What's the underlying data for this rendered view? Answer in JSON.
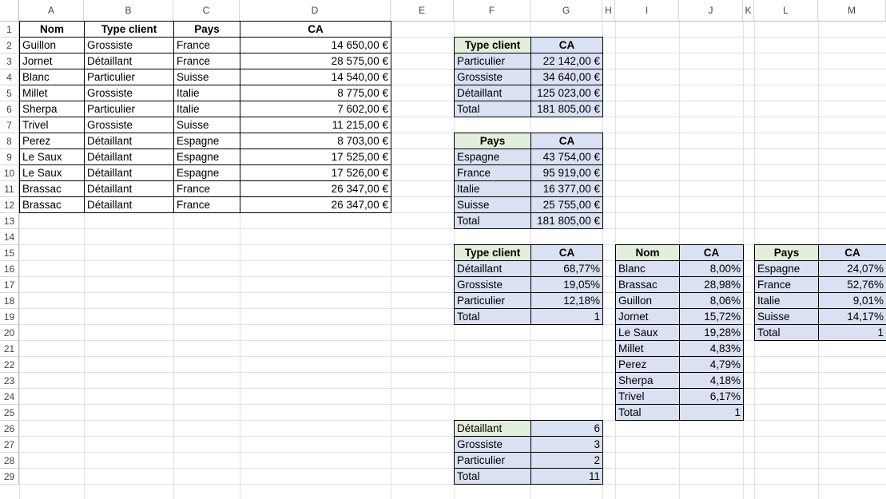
{
  "columns": [
    "A",
    "B",
    "C",
    "D",
    "E",
    "F",
    "G",
    "H",
    "I",
    "J",
    "K",
    "L",
    "M"
  ],
  "rows": [
    "1",
    "2",
    "3",
    "4",
    "5",
    "6",
    "7",
    "8",
    "9",
    "10",
    "11",
    "12",
    "13",
    "14",
    "15",
    "16",
    "17",
    "18",
    "19",
    "20",
    "21",
    "22",
    "23",
    "24",
    "25",
    "26",
    "27",
    "28",
    "29"
  ],
  "main_table": {
    "headers": [
      "Nom",
      "Type client",
      "Pays",
      "CA"
    ],
    "rows": [
      [
        "Guillon",
        "Grossiste",
        "France",
        "14 650,00 €"
      ],
      [
        "Jornet",
        "Détaillant",
        "France",
        "28 575,00 €"
      ],
      [
        "Blanc",
        "Particulier",
        "Suisse",
        "14 540,00 €"
      ],
      [
        "Millet",
        "Grossiste",
        "Italie",
        "8 775,00 €"
      ],
      [
        "Sherpa",
        "Particulier",
        "Italie",
        "7 602,00 €"
      ],
      [
        "Trivel",
        "Grossiste",
        "Suisse",
        "11 215,00 €"
      ],
      [
        "Perez",
        "Détaillant",
        "Espagne",
        "8 703,00 €"
      ],
      [
        "Le Saux",
        "Détaillant",
        "Espagne",
        "17 525,00 €"
      ],
      [
        "Le Saux",
        "Détaillant",
        "Espagne",
        "17 526,00 €"
      ],
      [
        "Brassac",
        "Détaillant",
        "France",
        "26 347,00 €"
      ],
      [
        "Brassac",
        "Détaillant",
        "France",
        "26 347,00 €"
      ]
    ]
  },
  "type_ca": {
    "headers": [
      "Type client",
      "CA"
    ],
    "rows": [
      [
        "Particulier",
        "22 142,00 €"
      ],
      [
        "Grossiste",
        "34 640,00 €"
      ],
      [
        "Détaillant",
        "125 023,00 €"
      ],
      [
        "Total",
        "181 805,00 €"
      ]
    ]
  },
  "pays_ca": {
    "headers": [
      "Pays",
      "CA"
    ],
    "rows": [
      [
        "Espagne",
        "43 754,00 €"
      ],
      [
        "France",
        "95 919,00 €"
      ],
      [
        "Italie",
        "16 377,00 €"
      ],
      [
        "Suisse",
        "25 755,00 €"
      ],
      [
        "Total",
        "181 805,00 €"
      ]
    ]
  },
  "type_pct": {
    "headers": [
      "Type client",
      "CA"
    ],
    "rows": [
      [
        "Détaillant",
        "68,77%"
      ],
      [
        "Grossiste",
        "19,05%"
      ],
      [
        "Particulier",
        "12,18%"
      ],
      [
        "Total",
        "1"
      ]
    ]
  },
  "nom_pct": {
    "headers": [
      "Nom",
      "CA"
    ],
    "rows": [
      [
        "Blanc",
        "8,00%"
      ],
      [
        "Brassac",
        "28,98%"
      ],
      [
        "Guillon",
        "8,06%"
      ],
      [
        "Jornet",
        "15,72%"
      ],
      [
        "Le Saux",
        "19,28%"
      ],
      [
        "Millet",
        "4,83%"
      ],
      [
        "Perez",
        "4,79%"
      ],
      [
        "Sherpa",
        "4,18%"
      ],
      [
        "Trivel",
        "6,17%"
      ],
      [
        "Total",
        "1"
      ]
    ]
  },
  "pays_pct": {
    "headers": [
      "Pays",
      "CA"
    ],
    "rows": [
      [
        "Espagne",
        "24,07%"
      ],
      [
        "France",
        "52,76%"
      ],
      [
        "Italie",
        "9,01%"
      ],
      [
        "Suisse",
        "14,17%"
      ],
      [
        "Total",
        "1"
      ]
    ]
  },
  "type_count": {
    "rows": [
      [
        "Détaillant",
        "6"
      ],
      [
        "Grossiste",
        "3"
      ],
      [
        "Particulier",
        "2"
      ],
      [
        "Total",
        "11"
      ]
    ]
  }
}
